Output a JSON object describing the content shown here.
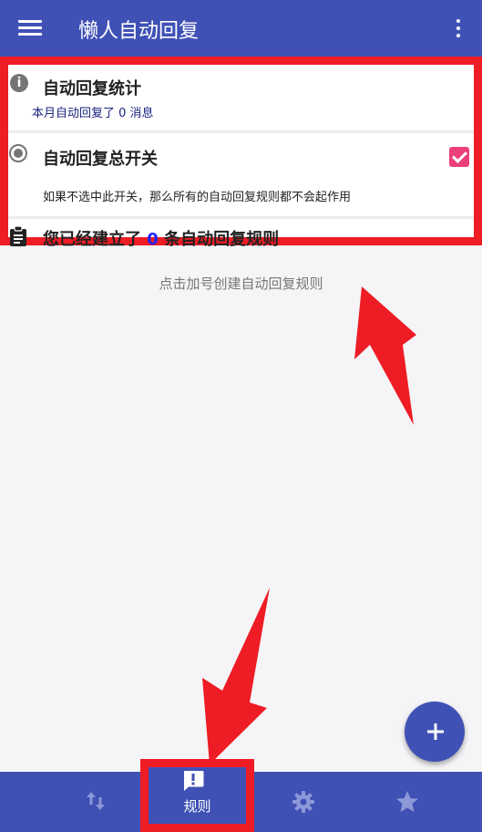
{
  "app_bar": {
    "title": "懒人自动回复",
    "menu_icon": "hamburger-menu-icon",
    "more_icon": "more-vert-icon"
  },
  "cards": {
    "stats": {
      "icon": "info-icon",
      "title": "自动回复统计",
      "subtitle": "本月自动回复了 0 消息"
    },
    "master_switch": {
      "icon": "radio-icon",
      "title": "自动回复总开关",
      "checked": true,
      "description": "如果不选中此开关，那么所有的自动回复规则都不会起作用"
    },
    "rules": {
      "icon": "clipboard-icon",
      "prefix": "您已经建立了",
      "count": "0",
      "suffix": "条自动回复规则"
    }
  },
  "hint": "点击加号创建自动回复规则",
  "fab": {
    "icon": "plus-icon"
  },
  "bottom_nav": {
    "items": [
      {
        "icon": "swap-vert-icon",
        "label": "",
        "active": false
      },
      {
        "icon": "rules-alert-icon",
        "label": "规则",
        "active": true
      },
      {
        "icon": "gear-icon",
        "label": "",
        "active": false
      },
      {
        "icon": "star-icon",
        "label": "",
        "active": false
      }
    ]
  },
  "colors": {
    "primary": "#3f51b5",
    "accent": "#ec407a",
    "highlight": "#ee1c25",
    "count": "#1e22ff"
  }
}
